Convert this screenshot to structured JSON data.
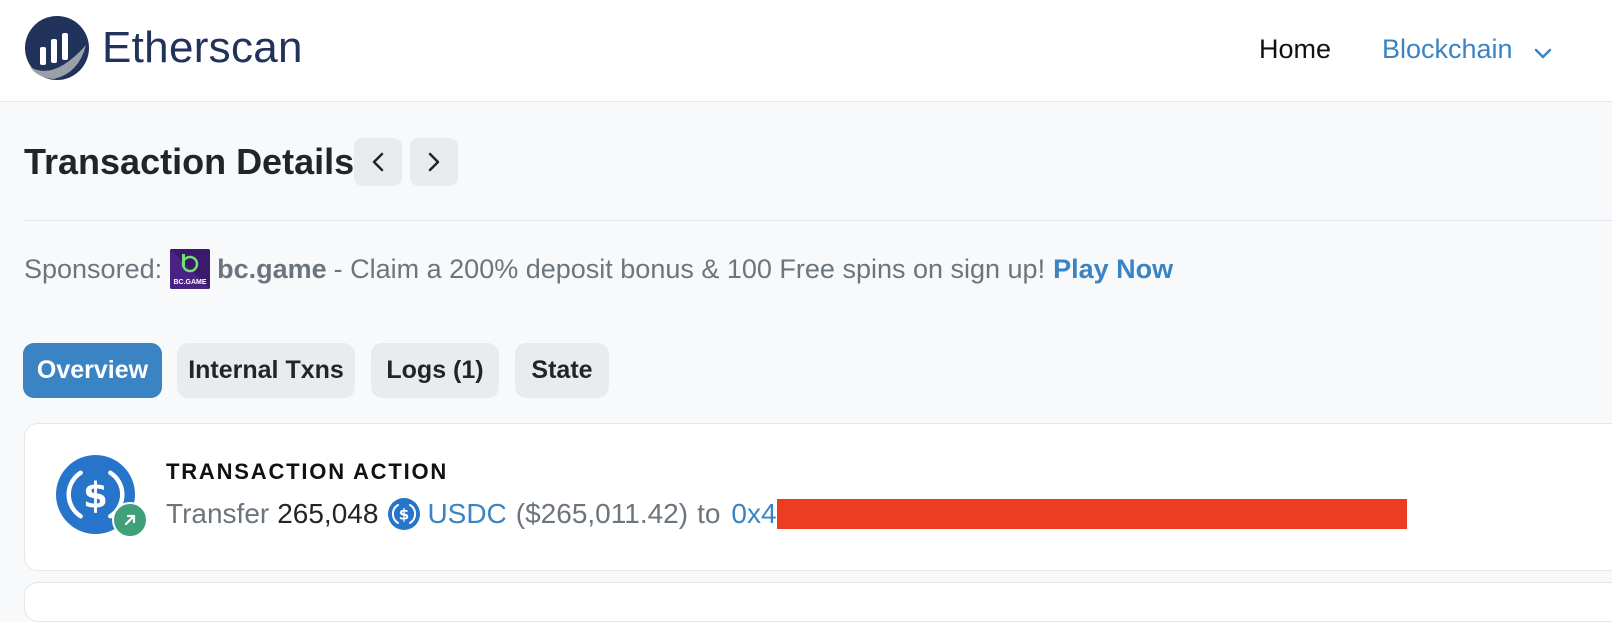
{
  "header": {
    "brand": "Etherscan",
    "nav": {
      "home": "Home",
      "blockchain": "Blockchain"
    }
  },
  "page": {
    "title": "Transaction Details"
  },
  "sponsored": {
    "label": "Sponsored:",
    "logo_text": "BC.GAME",
    "brand": "bc.game",
    "description": "- Claim a 200% deposit bonus & 100 Free spins on sign up!",
    "cta": "Play Now"
  },
  "tabs": [
    {
      "label": "Overview",
      "active": true
    },
    {
      "label": "Internal Txns",
      "active": false
    },
    {
      "label": "Logs (1)",
      "active": false
    },
    {
      "label": "State",
      "active": false
    }
  ],
  "action": {
    "heading": "TRANSACTION ACTION",
    "verb": "Transfer",
    "amount": "265,048",
    "token": "USDC",
    "usd_value": "($265,011.42)",
    "to": "to",
    "address_prefix": "0x4"
  },
  "icons": {
    "logo": "etherscan-logo",
    "token": "usdc-icon",
    "badge": "arrow-up-right-icon",
    "prev": "chevron-left-icon",
    "next": "chevron-right-icon",
    "dropdown": "chevron-down-icon"
  },
  "colors": {
    "accent": "#3a84c4",
    "brand_navy": "#21325b",
    "success": "#3fa07a",
    "usdc": "#2775ca",
    "redaction": "#ec3d22"
  }
}
